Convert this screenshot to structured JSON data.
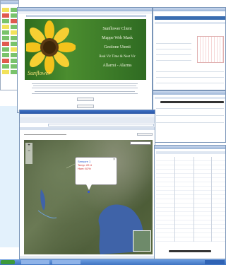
{
  "sunflower_site": {
    "logo_text": "Sunflower",
    "menu_lines": [
      "Sunflower Client",
      "Mappe Web Mask",
      "Gestione Utenti",
      "Real Vir Time & Nest Vir",
      "Allarmi - Alarms"
    ]
  },
  "map_popup": {
    "title": "Sensore 1",
    "lines": [
      "Temp: 22.4",
      "Hum: 61%"
    ]
  },
  "colors": {
    "taskbar": "#5b8fd6",
    "desktop_blue": "#e3f1fc",
    "sunflower_green": "#3f7f2a",
    "sunflower_yellow": "#f3c21b",
    "lake": "#3f63a8",
    "spreadsheet_green": "#79c36b",
    "spreadsheet_red": "#e05a4f",
    "spreadsheet_yellow": "#f2e25a"
  },
  "icons": [
    "close-icon",
    "zoom-plus-icon",
    "zoom-minus-icon",
    "map-marker-icon"
  ]
}
